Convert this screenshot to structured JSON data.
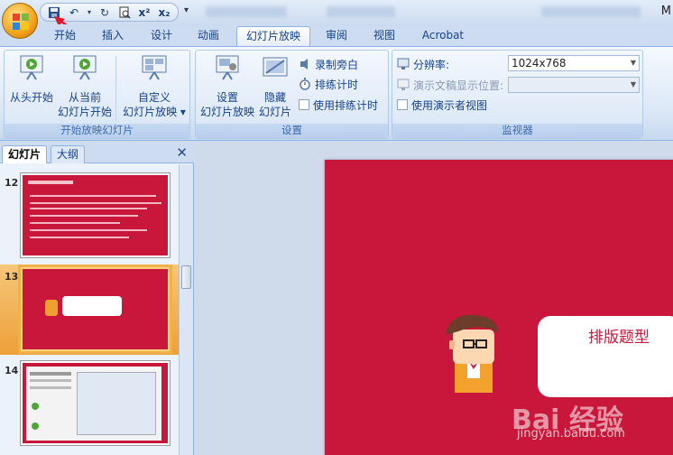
{
  "app": {
    "title_fragment": "M"
  },
  "qat": {
    "more": "▾"
  },
  "tabs": [
    {
      "label": "开始"
    },
    {
      "label": "插入"
    },
    {
      "label": "设计"
    },
    {
      "label": "动画"
    },
    {
      "label": "幻灯片放映"
    },
    {
      "label": "审阅"
    },
    {
      "label": "视图"
    },
    {
      "label": "Acrobat"
    }
  ],
  "ribbon": {
    "start_group": {
      "label": "开始放映幻灯片",
      "from_beginning": "从头开始",
      "from_current_l1": "从当前",
      "from_current_l2": "幻灯片开始",
      "custom_l1": "自定义",
      "custom_l2": "幻灯片放映 ▾"
    },
    "setup_group": {
      "label": "设置",
      "setup_l1": "设置",
      "setup_l2": "幻灯片放映",
      "hide_l1": "隐藏",
      "hide_l2": "幻灯片",
      "record_narration": "录制旁白",
      "rehearse_timings": "排练计时",
      "use_timings": "使用排练计时"
    },
    "monitors_group": {
      "label": "监视器",
      "resolution_label": "分辨率:",
      "resolution_value": "1024x768",
      "show_on_label": "演示文稿显示位置:",
      "presenter_view": "使用演示者视图"
    }
  },
  "panel": {
    "tab_slides": "幻灯片",
    "tab_outline": "大纲",
    "close": "✕",
    "slides": [
      {
        "num": "12"
      },
      {
        "num": "13"
      },
      {
        "num": "14"
      }
    ]
  },
  "slide": {
    "title": "排版题型"
  },
  "watermark": {
    "brand": "Bai 经验",
    "url": "jingyan.baidu.com"
  },
  "colors": {
    "accent": "#c8173a",
    "ribbon_blue": "#15428b",
    "selection": "#f2b04a"
  }
}
